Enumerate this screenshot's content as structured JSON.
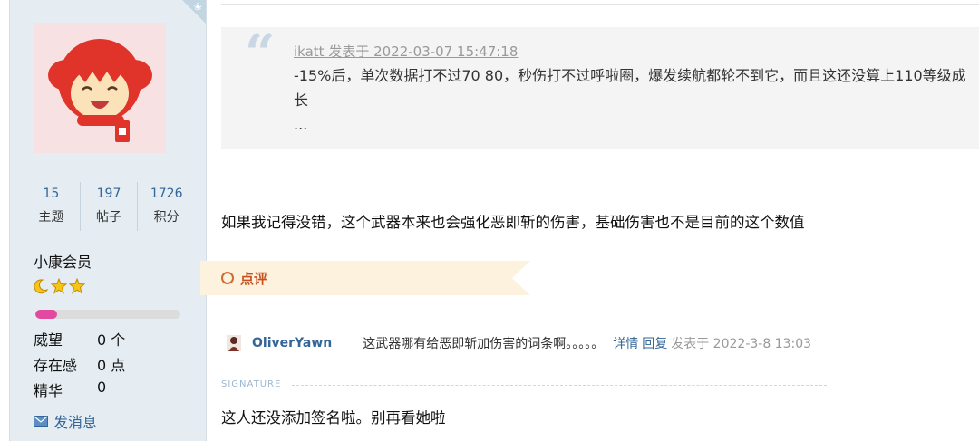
{
  "user": {
    "stats": [
      {
        "value": "15",
        "label": "主题"
      },
      {
        "value": "197",
        "label": "帖子"
      },
      {
        "value": "1726",
        "label": "积分"
      }
    ],
    "group": "小康会员",
    "level_progress": 0.15,
    "attributes": [
      {
        "label": "威望",
        "value": "0 个"
      },
      {
        "label": "存在感",
        "value": "0 点"
      },
      {
        "label": "精华",
        "value": "0"
      }
    ],
    "send_message": "发消息"
  },
  "quote": {
    "author_line": "ikatt 发表于 2022-03-07 15:47:18",
    "text": "-15%后，单次数据打不过70 80，秒伤打不过呼啦圈，爆发续航都轮不到它，而且这还没算上110等级成长",
    "ellipsis": "..."
  },
  "post": {
    "body": "如果我记得没错，这个武器本来也会强化恶即斩的伤害，基础伤害也不是目前的这个数值"
  },
  "rating": {
    "label": "点评"
  },
  "comment": {
    "user": "OliverYawn",
    "text": "这武器哪有给恶即斩加伤害的词条啊。。。。。",
    "detail": "详情",
    "reply": "回复",
    "time": "发表于 2022-3-8 13:03"
  },
  "signature": {
    "label": "SIGNATURE",
    "text": "这人还没添加签名啦。别再看她啦"
  },
  "icons": {
    "avatar": "red-hooded-cartoon-girl-avatar",
    "stars": [
      "moon-icon",
      "star-icon",
      "star-icon"
    ],
    "message": "envelope-icon",
    "rating": "circle-icon",
    "quote": "quote-mark-icon"
  },
  "colors": {
    "link": "#336699",
    "sidebar": "#e5edf2",
    "progress": "#e24aa0",
    "rating": "#c8501e"
  }
}
